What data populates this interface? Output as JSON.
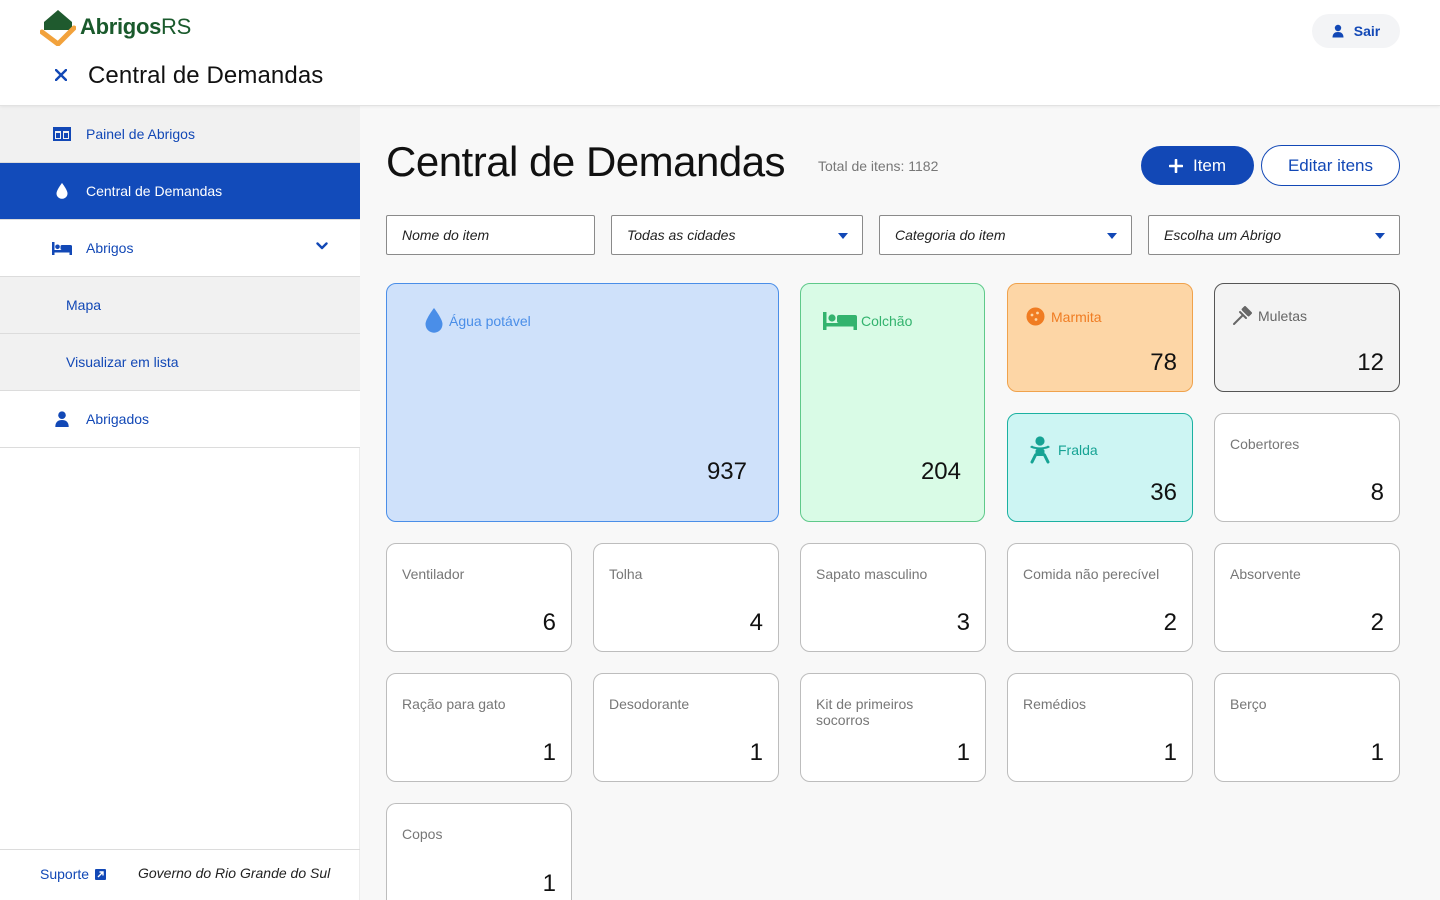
{
  "header": {
    "brand_bold": "Abrigos",
    "brand_light": "RS",
    "title": "Central de Demandas",
    "logout_label": "Sair"
  },
  "sidebar": {
    "items": [
      {
        "label": "Painel de Abrigos",
        "icon": "panel-icon"
      },
      {
        "label": "Central de Demandas",
        "icon": "drop-icon"
      },
      {
        "label": "Abrigos",
        "icon": "bed-icon"
      },
      {
        "label": "Mapa"
      },
      {
        "label": "Visualizar em lista"
      },
      {
        "label": "Abrigados",
        "icon": "person-icon"
      }
    ],
    "footer": {
      "support_label": "Suporte",
      "gov_label": "Governo do Rio Grande do Sul"
    }
  },
  "main": {
    "title": "Central de Demandas",
    "total": "Total de itens: 1182",
    "add_button": "Item",
    "edit_button": "Editar itens",
    "filters": {
      "name_placeholder": "Nome do item",
      "city": "Todas as cidades",
      "category": "Categoria do item",
      "shelter": "Escolha um Abrigo"
    },
    "cards": [
      {
        "name": "Água potável",
        "count": "937",
        "icon": "water-drop-icon",
        "color": "#4a8ee8",
        "bg": "#cfe1fa"
      },
      {
        "name": "Colchão",
        "count": "204",
        "icon": "bed-icon",
        "color": "#33b36e",
        "bg": "#d9fbe6"
      },
      {
        "name": "Marmita",
        "count": "78",
        "icon": "food-icon",
        "color": "#f07c22",
        "bg": "#fdd6a6"
      },
      {
        "name": "Muletas",
        "count": "12",
        "icon": "crutch-icon",
        "color": "#666666",
        "bg": "#f3f3f3"
      },
      {
        "name": "Fralda",
        "count": "36",
        "icon": "baby-icon",
        "color": "#16a394",
        "bg": "#cdf5f3"
      },
      {
        "name": "Cobertores",
        "count": "8"
      },
      {
        "name": "Ventilador",
        "count": "6"
      },
      {
        "name": "Tolha",
        "count": "4"
      },
      {
        "name": "Sapato masculino",
        "count": "3"
      },
      {
        "name": "Comida não perecível",
        "count": "2"
      },
      {
        "name": "Absorvente",
        "count": "2"
      },
      {
        "name": "Ração para gato",
        "count": "1"
      },
      {
        "name": "Desodorante",
        "count": "1"
      },
      {
        "name": "Kit de primeiros socorros",
        "count": "1"
      },
      {
        "name": "Remédios",
        "count": "1"
      },
      {
        "name": "Berço",
        "count": "1"
      },
      {
        "name": "Copos",
        "count": "1"
      }
    ]
  },
  "colors": {
    "primary": "#1248b6",
    "brand_green": "#1a5a2c",
    "brand_orange": "#f2a23c"
  }
}
